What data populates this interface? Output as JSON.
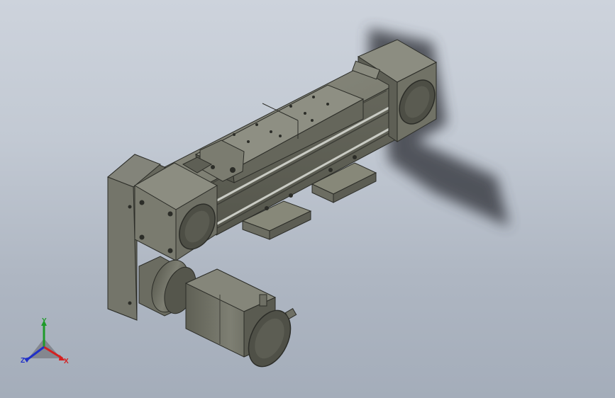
{
  "viewport": {
    "background_top": "#cdd3dc",
    "background_bottom": "#a4adba"
  },
  "model": {
    "body_color": "#6d6e62",
    "body_light": "#8a8b7f",
    "body_dark": "#4a4b43",
    "rail_color": "#c9cbc4",
    "shadow_color": "#3a3d44",
    "parts": [
      "linear-module-body",
      "carriage-block",
      "end-cap-right",
      "end-cap-left",
      "mounting-bracket",
      "servo-motor",
      "reducer-flange"
    ]
  },
  "triad": {
    "x_label": "X",
    "y_label": "Y",
    "z_label": "Z",
    "x_color": "#d42020",
    "y_color": "#1f9a2a",
    "z_color": "#2030c8"
  }
}
